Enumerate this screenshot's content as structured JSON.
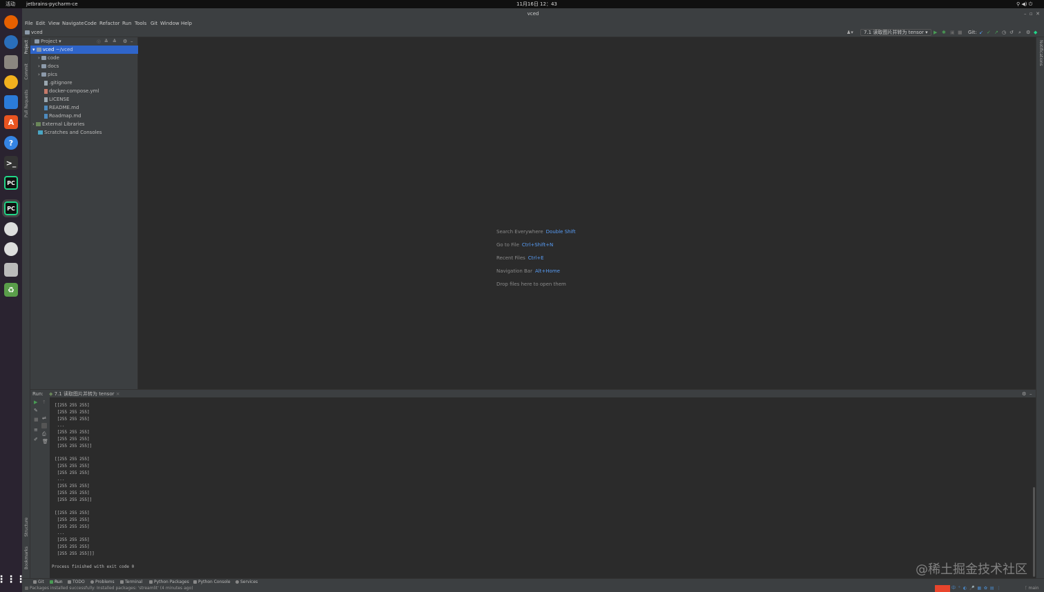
{
  "system_bar": {
    "activities": "活动",
    "app_name": "jetbrains-pycharm-ce",
    "clock": "11月16日 12：43"
  },
  "window": {
    "title": "vced"
  },
  "menu": [
    "File",
    "Edit",
    "View",
    "Navigate",
    "Code",
    "Refactor",
    "Run",
    "Tools",
    "Git",
    "Window",
    "Help"
  ],
  "navbar": {
    "breadcrumb": "vced",
    "run_config": "7.1 读取图片并转为 tensor",
    "git_label": "Git:"
  },
  "left_strip": {
    "project": "Project",
    "commit": "Commit",
    "pull_requests": "Pull Requests",
    "structure": "Structure",
    "bookmarks": "Bookmarks"
  },
  "right_strip": {
    "notifications": "Notifications"
  },
  "project_panel": {
    "title": "Project",
    "tree": [
      {
        "label": "vced",
        "suffix": "~/vced",
        "type": "root"
      },
      {
        "label": "code",
        "type": "folder"
      },
      {
        "label": "docs",
        "type": "folder"
      },
      {
        "label": "pics",
        "type": "folder"
      },
      {
        "label": ".gitignore",
        "type": "file"
      },
      {
        "label": "docker-compose.yml",
        "type": "file"
      },
      {
        "label": "LICENSE",
        "type": "file"
      },
      {
        "label": "README.md",
        "type": "file"
      },
      {
        "label": "Roadmap.md",
        "type": "file"
      },
      {
        "label": "External Libraries",
        "type": "lib"
      },
      {
        "label": "Scratches and Consoles",
        "type": "scratch"
      }
    ]
  },
  "editor_hints": [
    {
      "text": "Search Everywhere",
      "key": "Double Shift"
    },
    {
      "text": "Go to File",
      "key": "Ctrl+Shift+N"
    },
    {
      "text": "Recent Files",
      "key": "Ctrl+E"
    },
    {
      "text": "Navigation Bar",
      "key": "Alt+Home"
    },
    {
      "text": "Drop files here to open them",
      "key": ""
    }
  ],
  "run_panel": {
    "label": "Run:",
    "tab": "7.1 读取图片并转为 tensor",
    "console": [
      "[[255 255 255]",
      " [255 255 255]",
      " [255 255 255]",
      " ...",
      " [255 255 255]",
      " [255 255 255]",
      " [255 255 255]]",
      "",
      "[[255 255 255]",
      " [255 255 255]",
      " [255 255 255]",
      " ...",
      " [255 255 255]",
      " [255 255 255]",
      " [255 255 255]]",
      "",
      "[[255 255 255]",
      " [255 255 255]",
      " [255 255 255]",
      " ...",
      " [255 255 255]",
      " [255 255 255]",
      " [255 255 255]]]",
      "",
      "Process finished with exit code 0"
    ]
  },
  "bottom_tabs": [
    "Git",
    "Run",
    "TODO",
    "Problems",
    "Terminal",
    "Python Packages",
    "Python Console",
    "Services"
  ],
  "status": {
    "message": "Packages installed successfully: Installed packages: 'streamlit' (4 minutes ago)",
    "branch": "main"
  },
  "watermark": "@稀土掘金技术社区",
  "colors": {
    "selection": "#2f65ca",
    "link": "#589df6",
    "panel": "#3c3f41",
    "editor": "#2b2b2b"
  }
}
